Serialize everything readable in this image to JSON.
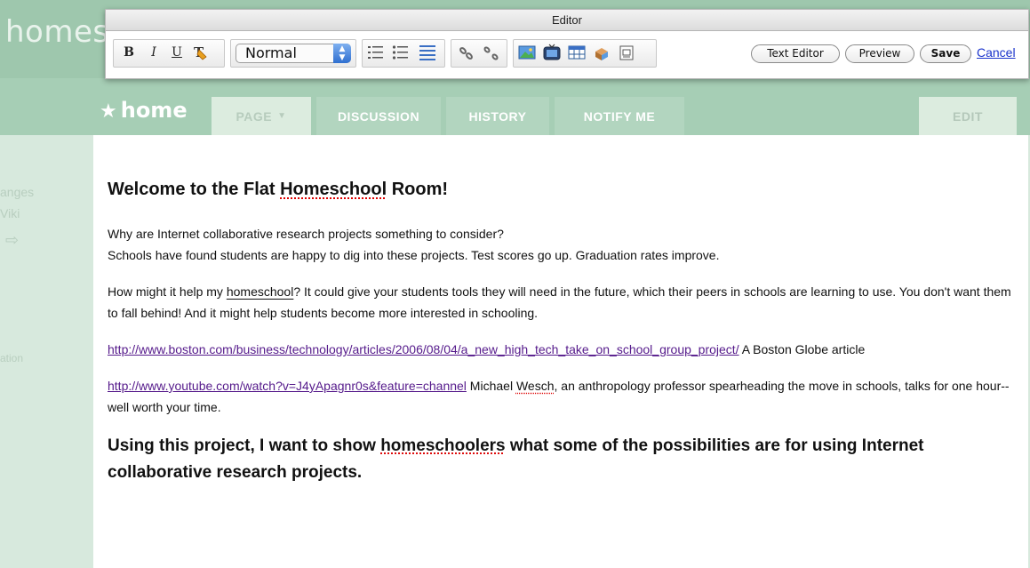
{
  "site": {
    "name": "homesc"
  },
  "page_title": "home",
  "tabs": [
    {
      "label": "PAGE",
      "active": true
    },
    {
      "label": "DISCUSSION",
      "active": false
    },
    {
      "label": "HISTORY",
      "active": false
    },
    {
      "label": "NOTIFY ME",
      "active": false
    }
  ],
  "edit_label": "EDIT",
  "sidebar": {
    "frag1": "anges",
    "frag2": "Viki",
    "frag3": "ation"
  },
  "editor": {
    "title": "Editor",
    "format_value": "Normal",
    "buttons": {
      "bold": "B",
      "italic": "I",
      "underline": "U"
    },
    "text_editor_label": "Text Editor",
    "preview_label": "Preview",
    "save_label": "Save",
    "cancel_label": "Cancel"
  },
  "content": {
    "heading": "Welcome to the Flat ",
    "heading_spell": "Homeschool",
    "heading_end": " Room!",
    "p1_line1": "Why are Internet collaborative research projects something to consider?",
    "p1_line2": "Schools have found students are happy to dig into these projects. Test scores go up. Graduation rates improve.",
    "p2_a": "How might it help my ",
    "p2_spell": "homeschool",
    "p2_b": "?  It could give your students tools they will need in the future, which their peers in schools are learning to use.  You don't want them to fall behind!  And it might help students become more interested in schooling.",
    "link1": "http://www.boston.com/business/technology/articles/2006/08/04/a_new_high_tech_take_on_school_group_project/",
    "link1_after": " A Boston Globe article",
    "link2": "http://www.youtube.com/watch?v=J4yApagnr0s&feature=channel",
    "link2_after_a": "  Michael ",
    "link2_spell": "Wesch",
    "link2_after_b": ", an anthropology professor spearheading the move in schools, talks for one hour--well worth your time.",
    "h2_a": "Using this project, I want to show ",
    "h2_spell": "homeschoolers",
    "h2_b": " what some of the possibilities are for using Internet collaborative research projects."
  }
}
